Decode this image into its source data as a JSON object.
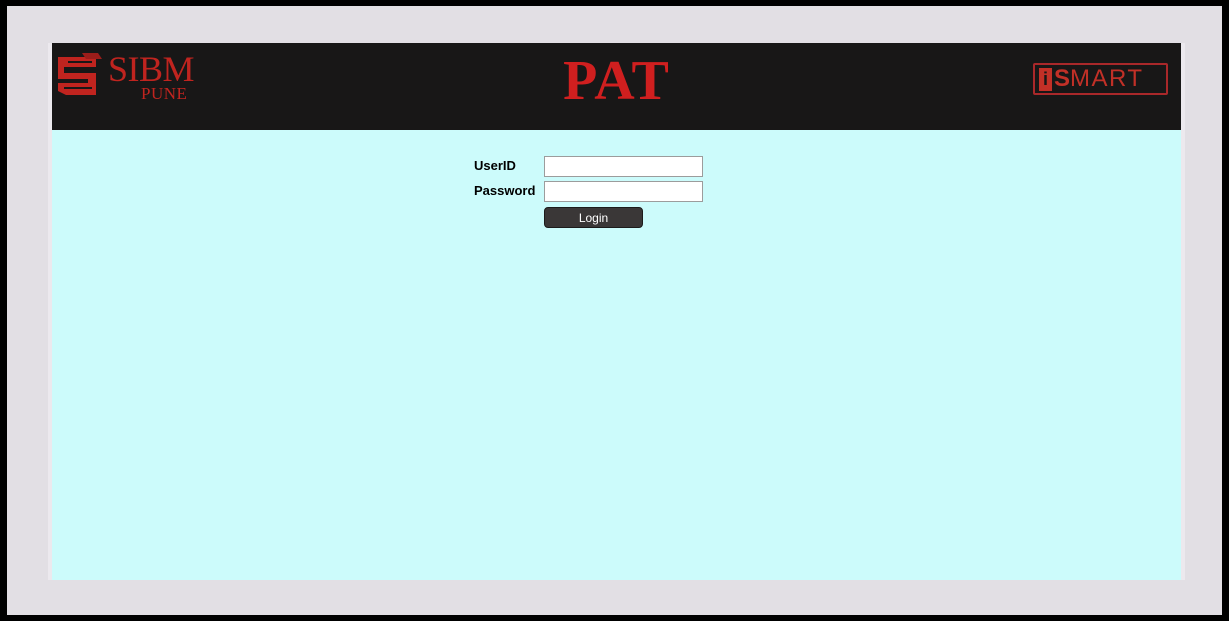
{
  "header": {
    "app_title": "PAT",
    "left_logo": {
      "name": "SIBM",
      "city": "PUNE",
      "icon": "sibm-emblem-icon"
    },
    "right_logo": {
      "first_letter": "i",
      "second_letter": "S",
      "rest": "MART",
      "icon": "ismart-logo"
    }
  },
  "login_form": {
    "userid_label": "UserID",
    "password_label": "Password",
    "userid_value": "",
    "password_value": "",
    "login_button": "Login"
  },
  "colors": {
    "header_background": "#181717",
    "content_background": "#ccfbfb",
    "frame_background": "#e2dfe4",
    "outer_border": "#000000",
    "brand_red": "#c0241f",
    "title_red": "#d01f1f",
    "button_background": "#3a3737"
  }
}
